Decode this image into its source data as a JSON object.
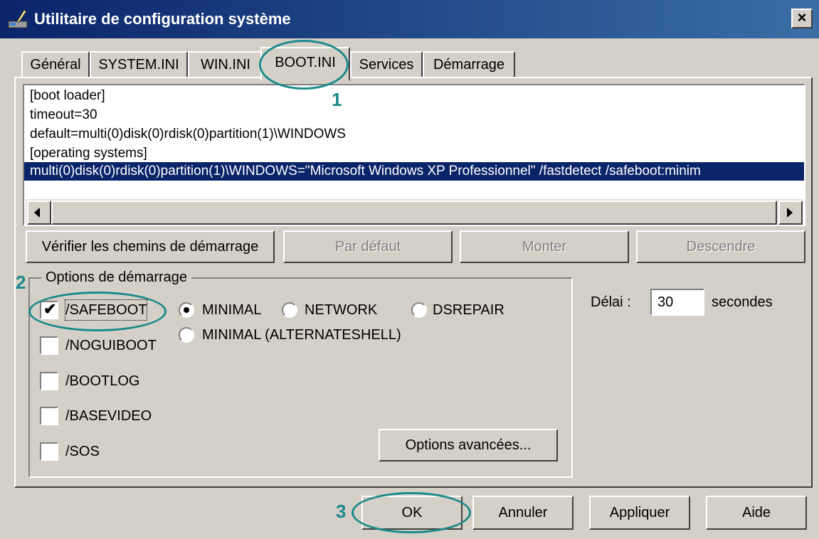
{
  "window": {
    "title": "Utilitaire de configuration système",
    "close_glyph": "×"
  },
  "tabs": [
    {
      "label": "Général"
    },
    {
      "label": "SYSTEM.INI"
    },
    {
      "label": "WIN.INI"
    },
    {
      "label": "BOOT.INI"
    },
    {
      "label": "Services"
    },
    {
      "label": "Démarrage"
    }
  ],
  "active_tab": "BOOT.INI",
  "bootini_lines": [
    "[boot loader]",
    "timeout=30",
    "default=multi(0)disk(0)rdisk(0)partition(1)\\WINDOWS",
    "[operating systems]",
    "multi(0)disk(0)rdisk(0)partition(1)\\WINDOWS=\"Microsoft Windows XP Professionnel\" /fastdetect /safeboot:minim"
  ],
  "selected_line": 4,
  "buttons": {
    "check_paths": "Vérifier les chemins de démarrage",
    "default": "Par défaut",
    "move_up": "Monter",
    "move_down": "Descendre",
    "advanced": "Options avancées...",
    "ok": "OK",
    "cancel": "Annuler",
    "apply": "Appliquer",
    "help": "Aide"
  },
  "boot_options": {
    "title": "Options de démarrage",
    "checkboxes": [
      {
        "label": "/SAFEBOOT",
        "checked": true
      },
      {
        "label": "/NOGUIBOOT",
        "checked": false
      },
      {
        "label": "/BOOTLOG",
        "checked": false
      },
      {
        "label": "/BASEVIDEO",
        "checked": false
      },
      {
        "label": "/SOS",
        "checked": false
      }
    ],
    "radios": [
      {
        "label": "MINIMAL",
        "selected": true
      },
      {
        "label": "NETWORK",
        "selected": false
      },
      {
        "label": "DSREPAIR",
        "selected": false
      },
      {
        "label": "MINIMAL (ALTERNATESHELL)",
        "selected": false
      }
    ]
  },
  "delay": {
    "label": "Délai :",
    "value": "30",
    "unit": "secondes"
  },
  "annotations": {
    "color": "#1c8a8a",
    "labels": [
      "1",
      "2",
      "3"
    ]
  },
  "colors": {
    "titlebar_start": "#0a246a",
    "titlebar_end": "#3a6ea5",
    "selection": "#0a246a",
    "face": "#d4d0c8"
  }
}
